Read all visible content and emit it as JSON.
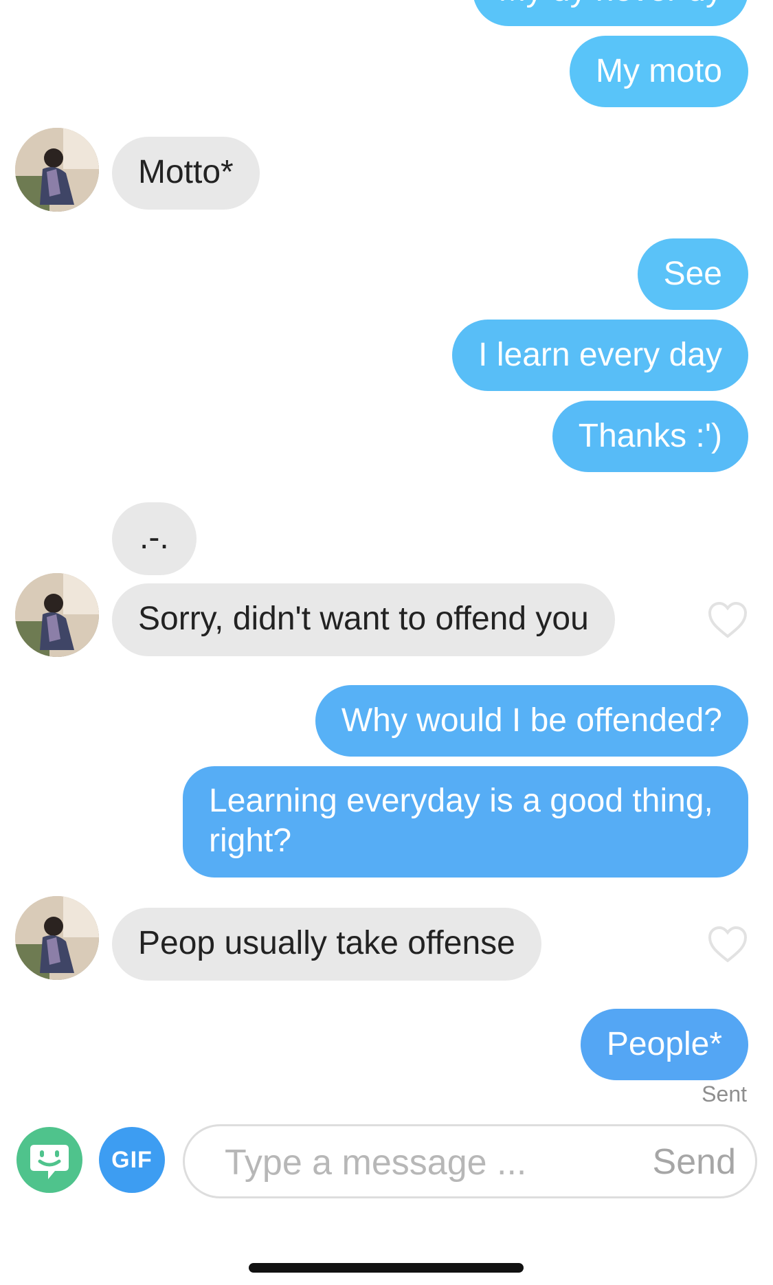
{
  "colors": {
    "outgoing_light": "#58c3f8",
    "outgoing_dark": "#52a8f3",
    "incoming": "#e8e8e8",
    "sticker_green": "#4fc38c",
    "gif_blue": "#3d9df2"
  },
  "messages": [
    {
      "id": "m0",
      "direction": "out",
      "text": "My dy never dy"
    },
    {
      "id": "m1",
      "direction": "out",
      "text": "My moto"
    },
    {
      "id": "m2",
      "direction": "in",
      "text": "Motto*",
      "avatar": true,
      "liked": false
    },
    {
      "id": "m3",
      "direction": "out",
      "text": "See"
    },
    {
      "id": "m4",
      "direction": "out",
      "text": "I learn every day"
    },
    {
      "id": "m5",
      "direction": "out",
      "text": "Thanks :')"
    },
    {
      "id": "m6",
      "direction": "in",
      "text": ".-.",
      "avatar": false
    },
    {
      "id": "m7",
      "direction": "in",
      "text": "Sorry, didn't want to offend you",
      "avatar": true,
      "like_icon": "heart-outline-icon"
    },
    {
      "id": "m8",
      "direction": "out",
      "text": "Why would I be offended?"
    },
    {
      "id": "m9",
      "direction": "out",
      "text": "Learning everyday is a good thing, right?"
    },
    {
      "id": "m10",
      "direction": "in",
      "text": "Peop usually take offense",
      "avatar": true,
      "like_icon": "heart-outline-icon"
    },
    {
      "id": "m11",
      "direction": "out",
      "text": "People*"
    }
  ],
  "status": {
    "last_message": "Sent"
  },
  "composer": {
    "sticker_icon": "sticker-face-icon",
    "gif_label": "GIF",
    "placeholder": "Type a message ...",
    "value": "",
    "send_label": "Send"
  }
}
